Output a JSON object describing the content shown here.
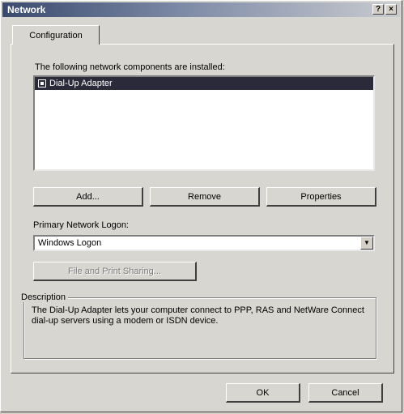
{
  "window": {
    "title": "Network",
    "help_glyph": "?",
    "close_glyph": "×"
  },
  "tabs": [
    {
      "label": "Configuration"
    }
  ],
  "components": {
    "heading": "The following network components are installed:",
    "items": [
      {
        "label": "Dial-Up Adapter",
        "icon": "network-adapter-icon",
        "selected": true
      }
    ]
  },
  "actions": {
    "add": "Add...",
    "remove": "Remove",
    "properties": "Properties"
  },
  "logon": {
    "label": "Primary Network Logon:",
    "value": "Windows Logon",
    "arrow": "▼"
  },
  "file_sharing": {
    "label": "File and Print Sharing..."
  },
  "description": {
    "title": "Description",
    "text": "The Dial-Up Adapter lets your computer connect to PPP, RAS and NetWare Connect dial-up servers using a modem or ISDN device."
  },
  "dialog_buttons": {
    "ok": "OK",
    "cancel": "Cancel"
  },
  "colors": {
    "face": "#d8d6d0",
    "selection": "#2a2a3a",
    "title_start": "#3a4a6e"
  }
}
